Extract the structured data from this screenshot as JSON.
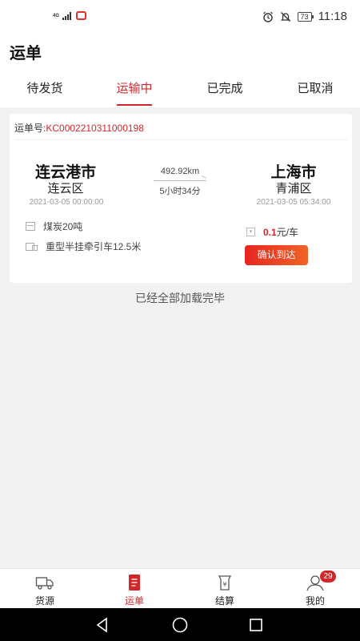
{
  "status_bar": {
    "network": "4G",
    "battery": "73",
    "time": "11:18"
  },
  "header": {
    "title": "运单"
  },
  "tabs": [
    {
      "label": "待发货",
      "active": false
    },
    {
      "label": "运输中",
      "active": true
    },
    {
      "label": "已完成",
      "active": false
    },
    {
      "label": "已取消",
      "active": false
    }
  ],
  "order": {
    "number_label": "运单号:",
    "number": "KC0002210311000198",
    "origin": {
      "city": "连云港市",
      "district": "连云区",
      "datetime": "2021-03-05 00:00:00"
    },
    "destination": {
      "city": "上海市",
      "district": "青浦区",
      "datetime": "2021-03-05 05:34:00"
    },
    "distance": "492.92km",
    "duration": "5小时34分",
    "cargo": "煤炭20吨",
    "vehicle": "重型半挂牵引车12.5米",
    "price_value": "0.1",
    "price_unit": "元/车",
    "confirm_button": "确认到达"
  },
  "list_end_text": "已经全部加载完毕",
  "bottom_nav": [
    {
      "label": "货源",
      "icon": "truck-icon",
      "active": false
    },
    {
      "label": "运单",
      "icon": "waybill-icon",
      "active": true
    },
    {
      "label": "结算",
      "icon": "yen-bag-icon",
      "active": false
    },
    {
      "label": "我的",
      "icon": "user-icon",
      "active": false,
      "badge": "29"
    }
  ],
  "colors": {
    "accent": "#d0282a",
    "button_gradient_start": "#e8251f",
    "button_gradient_end": "#f06326",
    "background": "#f2f2f2"
  }
}
